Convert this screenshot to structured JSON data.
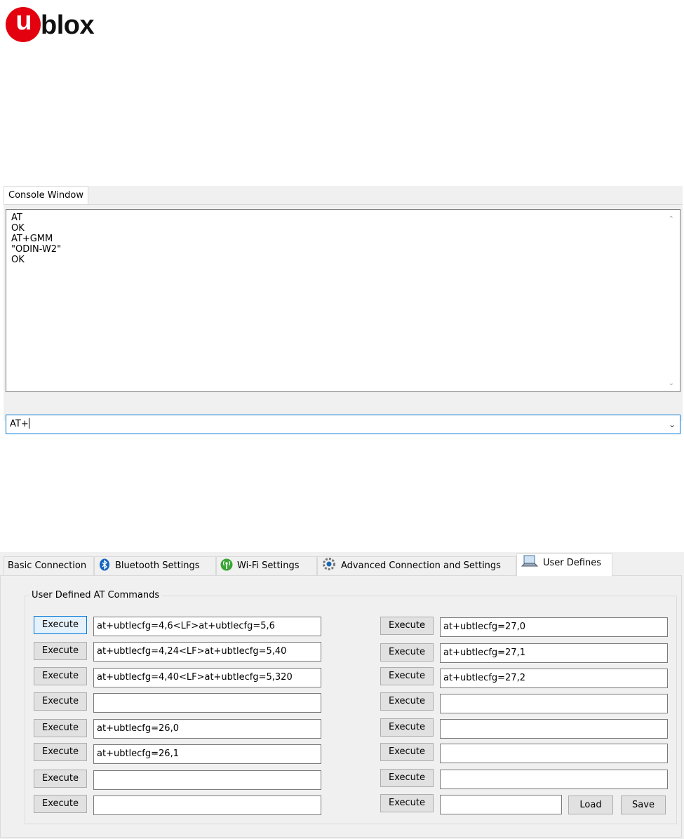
{
  "logo": {
    "letter": "u",
    "text": "blox"
  },
  "console": {
    "tab_label": "Console Window",
    "lines": [
      "AT",
      "OK",
      "AT+GMM",
      "\"ODIN-W2\"",
      "OK"
    ],
    "input_value": "AT+"
  },
  "tabs": [
    {
      "label": "Basic Connection",
      "icon": ""
    },
    {
      "label": "Bluetooth Settings",
      "icon": "bluetooth-icon"
    },
    {
      "label": "Wi-Fi Settings",
      "icon": "wifi-antenna-icon"
    },
    {
      "label": "Advanced Connection and Settings",
      "icon": "gear-icon"
    },
    {
      "label": "User Defines",
      "icon": "laptop-icon"
    }
  ],
  "active_tab": "User Defines",
  "user_defines": {
    "group_title": "User Defined AT Commands",
    "execute_label": "Execute",
    "left": [
      "at+ubtlecfg=4,6<LF>at+ubtlecfg=5,6",
      "at+ubtlecfg=4,24<LF>at+ubtlecfg=5,40",
      "at+ubtlecfg=4,40<LF>at+ubtlecfg=5,320",
      "",
      "at+ubtlecfg=26,0",
      "at+ubtlecfg=26,1",
      "",
      ""
    ],
    "right": [
      "at+ubtlecfg=27,0",
      "at+ubtlecfg=27,1",
      "at+ubtlecfg=27,2",
      "",
      "",
      "",
      "",
      ""
    ],
    "load_label": "Load",
    "save_label": "Save"
  },
  "colors": {
    "brand_red": "#e3000f",
    "focus_blue": "#0078d7"
  }
}
